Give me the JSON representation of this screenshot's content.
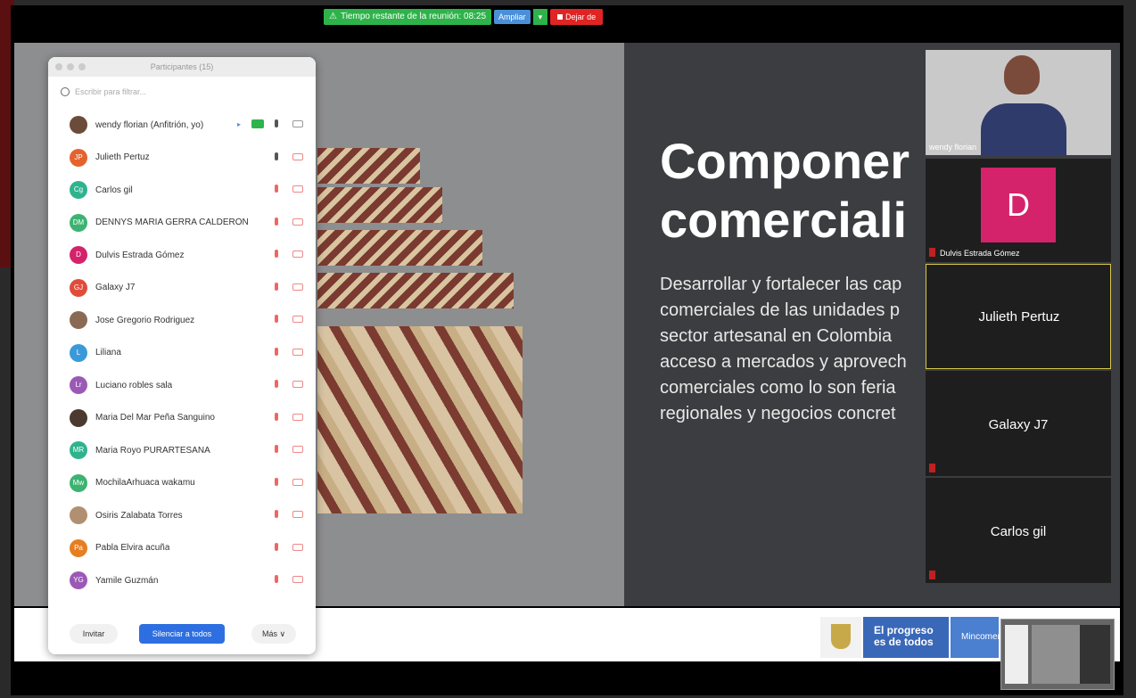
{
  "meeting_bar": {
    "timer": "Tiempo restante de la reunión: 08:25",
    "extend": "Ampliar",
    "leave": "Dejar de"
  },
  "slide": {
    "title": "Componer\ncomerciali",
    "body": "Desarrollar y fortalecer las cap\ncomerciales de las unidades p\nsector artesanal en Colombia\nacceso a mercados y aprovech\ncomerciales como lo son feria\nregionales y negocios concret"
  },
  "footer_banner": {
    "progreso": "El progreso\nes de todos",
    "ministry": "Mincomercio"
  },
  "participants_panel": {
    "title": "Participantes (15)",
    "search_placeholder": "Escribir para filtrar...",
    "participants": [
      {
        "name": "wendy florian (Anfitrión, yo)",
        "initials": "",
        "color": "#6b4b3a",
        "mic_on": true,
        "cam_on": true
      },
      {
        "name": "Julieth Pertuz",
        "initials": "JP",
        "color": "#e5622e",
        "mic_on": true,
        "cam_on": false
      },
      {
        "name": "Carlos gil",
        "initials": "Cg",
        "color": "#2fb38f",
        "mic_on": false,
        "cam_on": false
      },
      {
        "name": "DENNYS MARIA GERRA CALDERÓN",
        "initials": "DM",
        "color": "#3cb371",
        "mic_on": false,
        "cam_on": false
      },
      {
        "name": "Dulvis Estrada Gómez",
        "initials": "D",
        "color": "#d4236b",
        "mic_on": false,
        "cam_on": false
      },
      {
        "name": "Galaxy J7",
        "initials": "GJ",
        "color": "#e04c3a",
        "mic_on": false,
        "cam_on": false
      },
      {
        "name": "Jose Gregorio Rodriguez",
        "initials": "",
        "color": "#8a6a55",
        "mic_on": false,
        "cam_on": false
      },
      {
        "name": "Liliana",
        "initials": "L",
        "color": "#3a9ad9",
        "mic_on": false,
        "cam_on": false
      },
      {
        "name": "Luciano robles sala",
        "initials": "Lr",
        "color": "#9b59b6",
        "mic_on": false,
        "cam_on": false
      },
      {
        "name": "Maria Del Mar Peña Sanguino",
        "initials": "",
        "color": "#4a3a30",
        "mic_on": false,
        "cam_on": false
      },
      {
        "name": "Maria Royo PURARTESANA",
        "initials": "MR",
        "color": "#2fb38f",
        "mic_on": false,
        "cam_on": false
      },
      {
        "name": "MochilaArhuaca wakamu",
        "initials": "Mw",
        "color": "#3cb371",
        "mic_on": false,
        "cam_on": false
      },
      {
        "name": "Osiris Zalabata Torres",
        "initials": "",
        "color": "#b09070",
        "mic_on": false,
        "cam_on": false
      },
      {
        "name": "Pabla Elvira acuña",
        "initials": "Pa",
        "color": "#e67e22",
        "mic_on": false,
        "cam_on": false
      },
      {
        "name": "Yamile Guzmán",
        "initials": "YG",
        "color": "#9b59b6",
        "mic_on": false,
        "cam_on": false
      }
    ],
    "buttons": {
      "invite": "Invitar",
      "mute_all": "Silenciar a todos",
      "more": "Más ∨"
    }
  },
  "video_tiles": {
    "wendy": "wendy florian",
    "dulvis": "Dulvis Estrada Gómez",
    "dulvis_initial": "D",
    "julieth": "Julieth Pertuz",
    "galaxy": "Galaxy J7",
    "carlos": "Carlos gil"
  }
}
